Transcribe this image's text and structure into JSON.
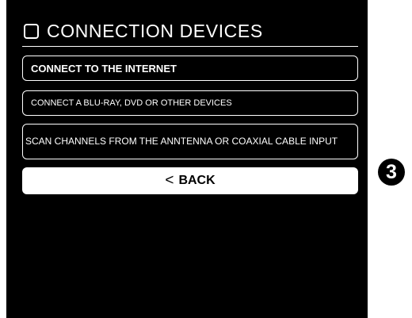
{
  "header": {
    "title": "CONNECTION DEVICES"
  },
  "options": [
    {
      "label": "CONNECT TO THE INTERNET"
    },
    {
      "label": "CONNECT A  BLU-RAY, DVD OR OTHER DEVICES"
    },
    {
      "label": "SCAN CHANNELS FROM THE ANNTENNA OR COAXIAL CABLE INPUT"
    }
  ],
  "back": {
    "chevron": "<",
    "label": "BACK"
  },
  "step_badge": "3"
}
